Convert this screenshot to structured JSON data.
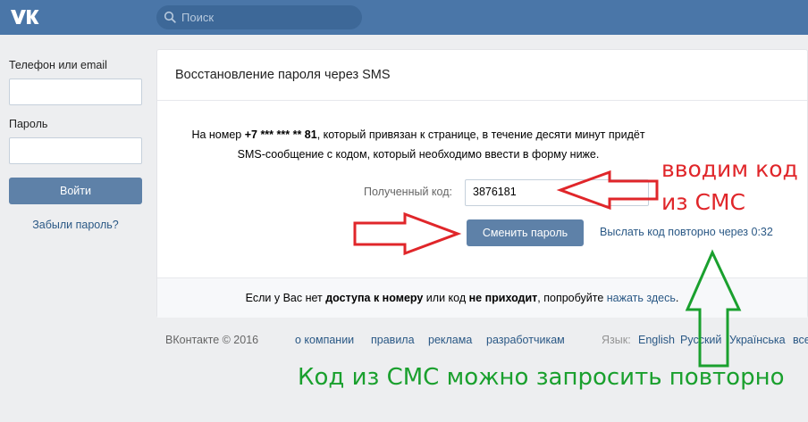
{
  "header": {
    "logo": "VK",
    "search_placeholder": "Поиск"
  },
  "login": {
    "phone_label": "Телефон или email",
    "password_label": "Пароль",
    "login_button": "Войти",
    "forgot_link": "Забыли пароль?"
  },
  "card": {
    "title": "Восстановление пароля через SMS",
    "info_part1": "На номер ",
    "info_phone": "+7 *** *** ** 81",
    "info_part2": ", который привязан к странице, в течение десяти минут придёт",
    "info_line2": "SMS-сообщение с кодом, который необходимо ввести в форму ниже.",
    "code_label": "Полученный код:",
    "code_value": "3876181",
    "change_button": "Сменить пароль",
    "resend_link": "Выслать код повторно через 0:32",
    "footer_part1": "Если у Вас нет ",
    "footer_bold1": "доступа к номеру",
    "footer_part2": " или код ",
    "footer_bold2": "не приходит",
    "footer_part3": ", попробуйте ",
    "footer_link": "нажать здесь",
    "footer_end": "."
  },
  "page_footer": {
    "copyright": "ВКонтакте © 2016",
    "links": [
      "о компании",
      "правила",
      "реклама",
      "разработчикам"
    ],
    "lang_label": "Язык:",
    "languages": [
      "English",
      "Русский",
      "Українська",
      "все"
    ]
  },
  "annotations": {
    "red_line1": "вводим код",
    "red_line2": "из СМС",
    "green": "Код из СМС можно запросить повторно",
    "red_color": "#e0262a",
    "green_color": "#1aa02e"
  }
}
